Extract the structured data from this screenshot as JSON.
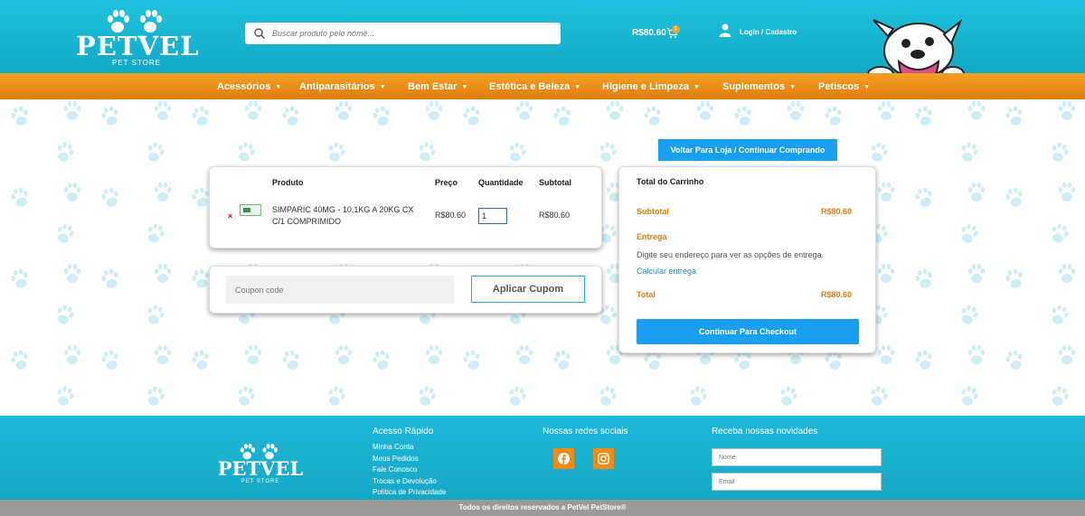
{
  "header": {
    "logo_text": "PETVEL",
    "logo_subtitle": "PET STORE",
    "search_placeholder": "Buscar produto pelo nome...",
    "cart_total": "R$80.60",
    "cart_count": "1",
    "login_label": "Login / Cadastro"
  },
  "nav": {
    "items": [
      {
        "label": "Acessórios"
      },
      {
        "label": "Antiparasitários"
      },
      {
        "label": "Bem Estar"
      },
      {
        "label": "Estética e Beleza"
      },
      {
        "label": "Higiene e Limpeza"
      },
      {
        "label": "Suplementos"
      },
      {
        "label": "Petiscos"
      }
    ]
  },
  "main": {
    "back_button": "Voltar Para Loja / Continuar Comprando",
    "cart_table": {
      "headers": {
        "product": "Produto",
        "price": "Preço",
        "quantity": "Quantidade",
        "subtotal": "Subtotal"
      },
      "rows": [
        {
          "remove": "×",
          "name": "SIMPARIC 40MG - 10,1KG A 20KG CX C/1 COMPRIMIDO",
          "price": "R$80.60",
          "quantity": "1",
          "subtotal": "R$80.60"
        }
      ]
    },
    "coupon": {
      "placeholder": "Coupon code",
      "button": "Aplicar Cupom"
    },
    "totals": {
      "title": "Total do Carrinho",
      "subtotal_label": "Subtotal",
      "subtotal_value": "R$80.60",
      "shipping_label": "Entrega",
      "shipping_note": "Digite seu endereço para ver as opções de entrega.",
      "shipping_link": "Calcular entrega",
      "total_label": "Total",
      "total_value": "R$80.60",
      "checkout_button": "Continuar Para Checkout"
    }
  },
  "footer": {
    "logo_text": "PETVEL",
    "logo_subtitle": "PET STORE",
    "quick_access": {
      "heading": "Acesso Rápido",
      "links": [
        "Minha Conta",
        "Meus Pedidos",
        "Fale Conosco",
        "Trocas e Devolução",
        "Política de Privacidade"
      ]
    },
    "social": {
      "heading": "Nossas redes sociais",
      "icons": [
        "facebook-icon",
        "instagram-icon"
      ]
    },
    "newsletter": {
      "heading": "Receba nossas novidades",
      "name_placeholder": "Nome",
      "email_placeholder": "Email"
    },
    "copyright": "Todos os direitos reservados a PetVel PetStore®"
  },
  "colors": {
    "teal": "#1fc2de",
    "orange": "#e07d0e",
    "button_blue": "#1a9ef0",
    "paw": "#bfe8f2"
  }
}
